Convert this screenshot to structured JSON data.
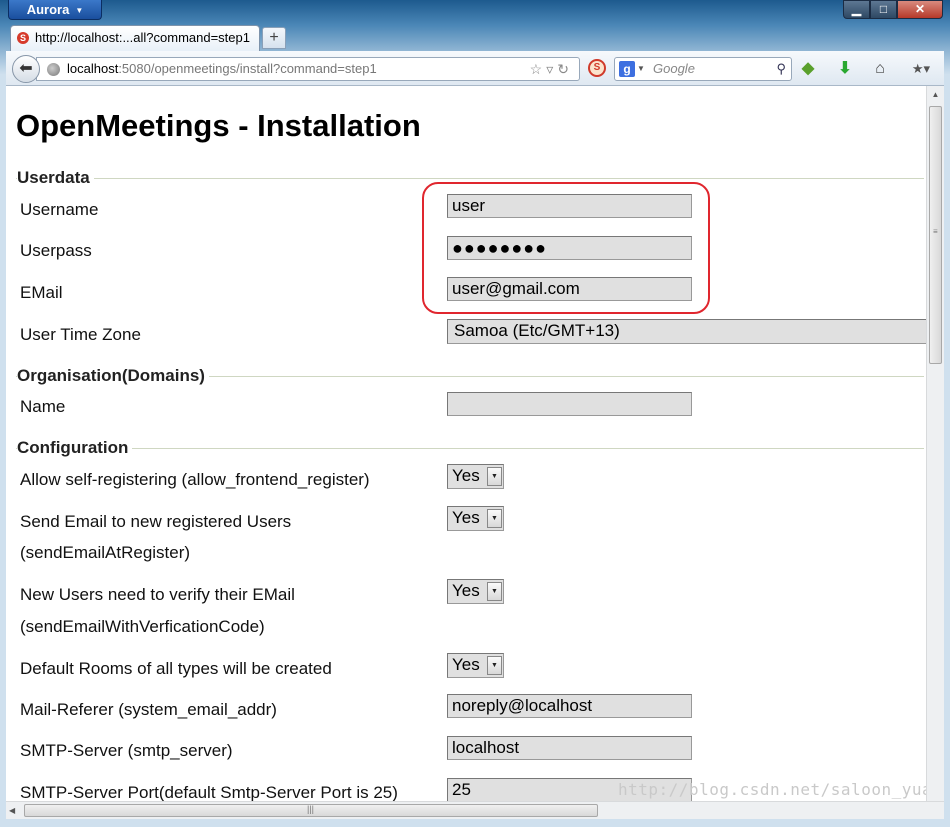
{
  "browser": {
    "menu_button": "Aurora",
    "tab_title": "http://localhost:...all?command=step1",
    "new_tab_symbol": "+",
    "url_host": "localhost",
    "url_rest": ":5080/openmeetings/install?command=step1",
    "search_placeholder": "Google",
    "window_controls": {
      "minimize": "▁",
      "maximize": "□",
      "close": "✕"
    }
  },
  "page": {
    "title": "OpenMeetings - Installation",
    "sections": {
      "userdata": "Userdata",
      "organisation": "Organisation(Domains)",
      "configuration": "Configuration"
    },
    "userdata": {
      "username_label": "Username",
      "username_value": "user",
      "userpass_label": "Userpass",
      "userpass_value": "●●●●●●●●",
      "email_label": "EMail",
      "email_value": "user@gmail.com",
      "timezone_label": "User Time Zone",
      "timezone_value": "Samoa (Etc/GMT+13)"
    },
    "organisation": {
      "name_label": "Name",
      "name_value": ""
    },
    "configuration": {
      "allow_self_register_label": "Allow self-registering (allow_frontend_register)",
      "allow_self_register_value": "Yes",
      "send_email_label_1": "Send Email to new registered Users",
      "send_email_label_2": "(sendEmailAtRegister)",
      "send_email_value": "Yes",
      "verify_email_label_1": "New Users need to verify their EMail",
      "verify_email_label_2": "(sendEmailWithVerficationCode)",
      "verify_email_value": "Yes",
      "default_rooms_label": "Default Rooms of all types will be created",
      "default_rooms_value": "Yes",
      "mail_referer_label": "Mail-Referer (system_email_addr)",
      "mail_referer_value": "noreply@localhost",
      "smtp_server_label": "SMTP-Server (smtp_server)",
      "smtp_server_value": "localhost",
      "smtp_port_label": "SMTP-Server Port(default Smtp-Server Port is 25)",
      "smtp_port_value": "25"
    }
  },
  "watermark": "http://blog.csdn.net/saloon_yuan"
}
